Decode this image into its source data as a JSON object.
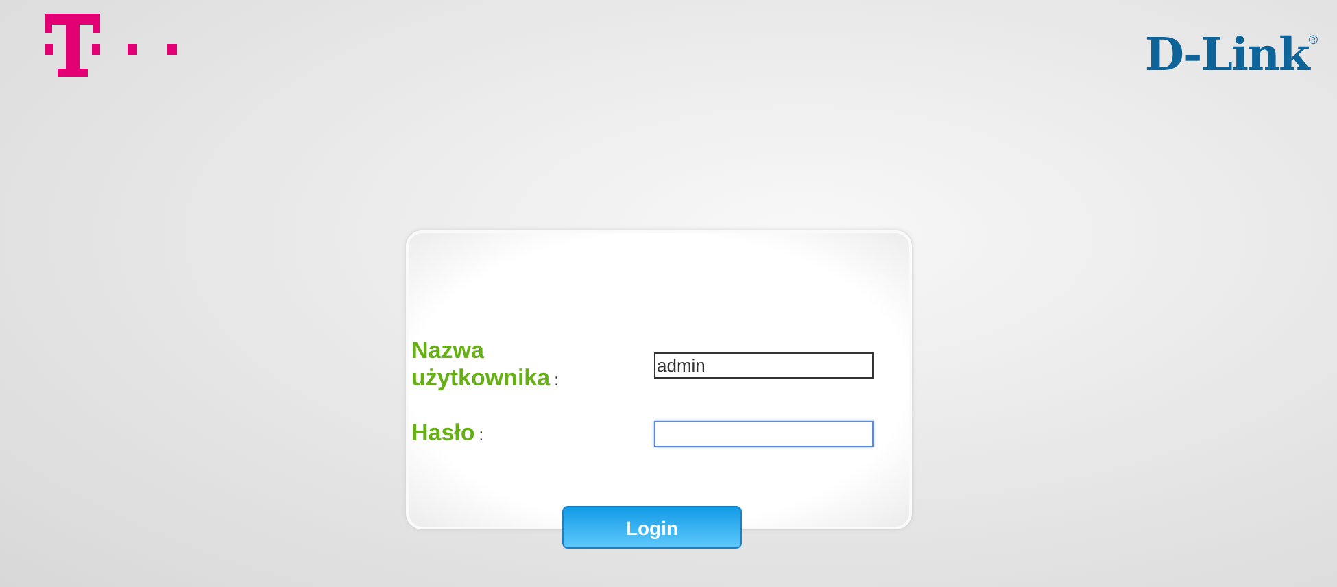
{
  "header": {
    "brand_logo": "D-Link",
    "registered_mark": "®"
  },
  "login_form": {
    "fields": [
      {
        "label": "Nazwa użytkownika",
        "separator": ":",
        "value": "admin",
        "focused": false
      },
      {
        "label": "Hasło",
        "separator": ":",
        "focused": true
      }
    ],
    "button": "Login"
  }
}
